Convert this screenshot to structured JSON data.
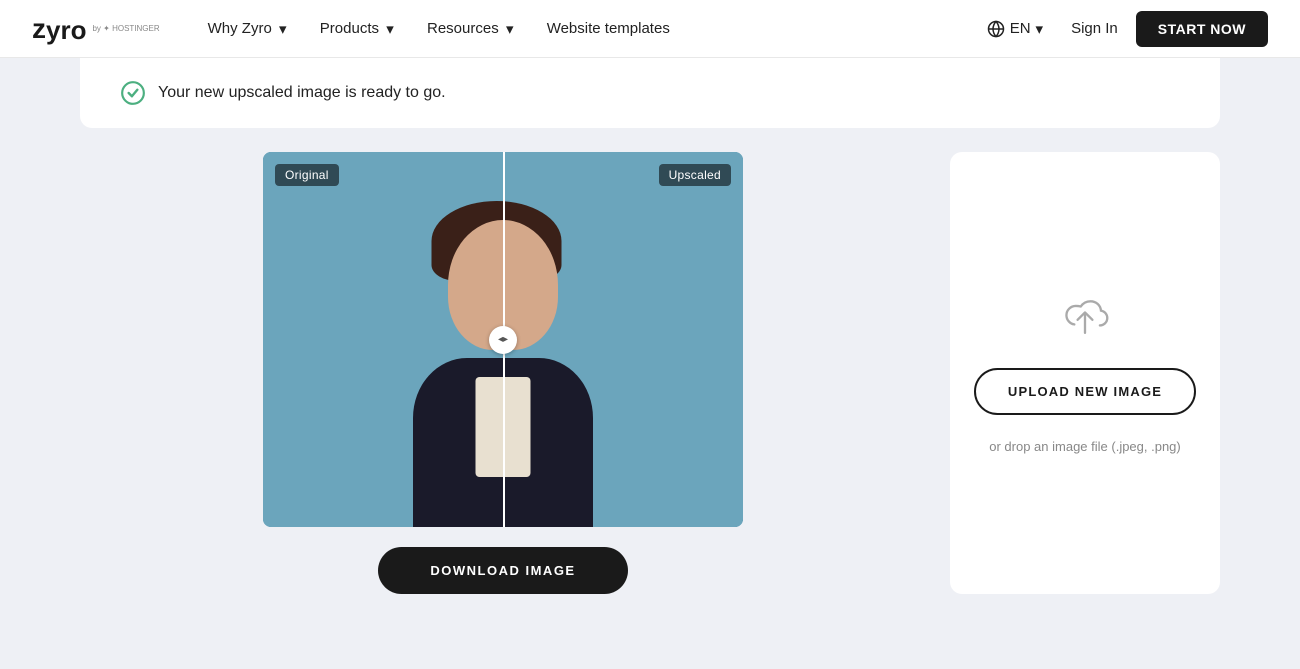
{
  "nav": {
    "logo_main": "zyro",
    "logo_by": "by",
    "logo_sub": "HOSTINGER",
    "links": [
      {
        "label": "Why Zyro",
        "has_dropdown": true
      },
      {
        "label": "Products",
        "has_dropdown": true
      },
      {
        "label": "Resources",
        "has_dropdown": true
      },
      {
        "label": "Website templates",
        "has_dropdown": false
      }
    ],
    "lang_label": "EN",
    "signin_label": "Sign In",
    "start_label": "START NOW"
  },
  "success": {
    "message": "Your new upscaled image is ready to go."
  },
  "image_compare": {
    "original_label": "Original",
    "upscaled_label": "Upscaled"
  },
  "download": {
    "button_label": "DOWNLOAD IMAGE"
  },
  "upload_panel": {
    "button_label": "UPLOAD NEW IMAGE",
    "drop_hint": "or drop an image file (.jpeg, .png)"
  }
}
